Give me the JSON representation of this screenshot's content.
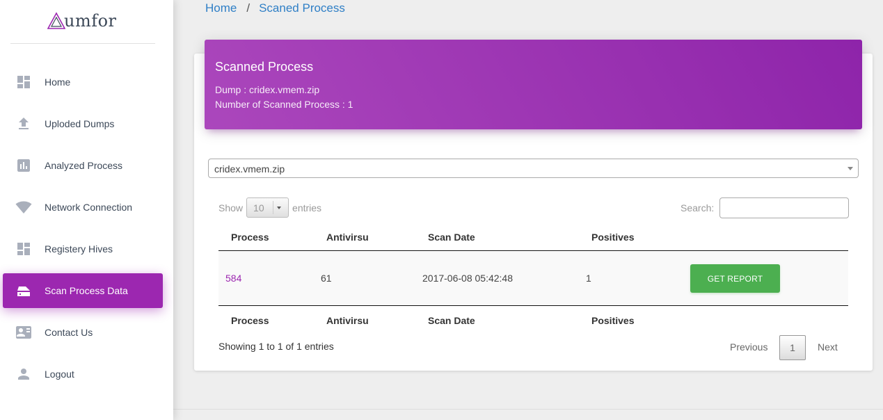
{
  "app": {
    "logo_text": "umfor"
  },
  "sidebar": {
    "items": [
      {
        "label": "Home",
        "icon": "dashboard-icon"
      },
      {
        "label": "Uploded Dumps",
        "icon": "upload-icon"
      },
      {
        "label": "Analyzed Process",
        "icon": "bar-chart-icon"
      },
      {
        "label": "Network Connection",
        "icon": "wifi-icon"
      },
      {
        "label": "Registery Hives",
        "icon": "dashboard-icon"
      },
      {
        "label": "Scan Process Data",
        "icon": "hard-drive-icon",
        "active": true
      },
      {
        "label": "Contact Us",
        "icon": "contact-card-icon"
      },
      {
        "label": "Logout",
        "icon": "person-icon"
      }
    ]
  },
  "breadcrumb": {
    "home": "Home",
    "separator": "/",
    "current": "Scaned Process"
  },
  "card": {
    "title": "Scanned Process",
    "dump_line": "Dump : cridex.vmem.zip",
    "count_line": "Number of Scanned Process : 1"
  },
  "dump_select": {
    "value": "cridex.vmem.zip"
  },
  "table_controls": {
    "show_label": "Show",
    "length_value": "10",
    "entries_label": "entries",
    "search_label": "Search:",
    "search_value": ""
  },
  "table": {
    "columns": [
      "Process",
      "Antivirsu",
      "Scan Date",
      "Positives"
    ],
    "rows": [
      {
        "process": "584",
        "antivirus": "61",
        "scan_date": "2017-06-08 05:42:48",
        "positives": "1",
        "action": "GET REPORT"
      }
    ]
  },
  "pagination": {
    "info": "Showing 1 to 1 of 1 entries",
    "previous": "Previous",
    "page": "1",
    "next": "Next"
  },
  "colors": {
    "accent": "#9c27b0",
    "success": "#4caf50",
    "link": "#2f7fc6"
  }
}
